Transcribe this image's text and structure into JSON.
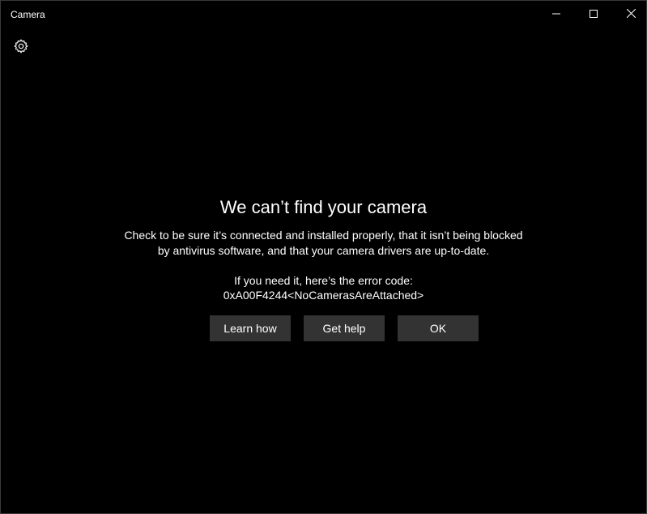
{
  "window": {
    "title": "Camera"
  },
  "titlebar_icons": {
    "minimize": "minimize-icon",
    "maximize": "maximize-icon",
    "close": "close-icon"
  },
  "settings": {
    "icon": "gear-icon"
  },
  "error": {
    "heading": "We can’t find your camera",
    "description_line1": "Check to be sure it’s connected and installed properly, that it isn’t being blocked",
    "description_line2": "by antivirus software, and that your camera drivers are up-to-date.",
    "code_intro": "If you need it, here’s the error code:",
    "code": "0xA00F4244<NoCamerasAreAttached>"
  },
  "actions": {
    "learn_how": "Learn how",
    "get_help": "Get help",
    "ok": "OK"
  },
  "colors": {
    "background": "#000000",
    "text": "#ffffff",
    "button_bg": "#333333"
  }
}
